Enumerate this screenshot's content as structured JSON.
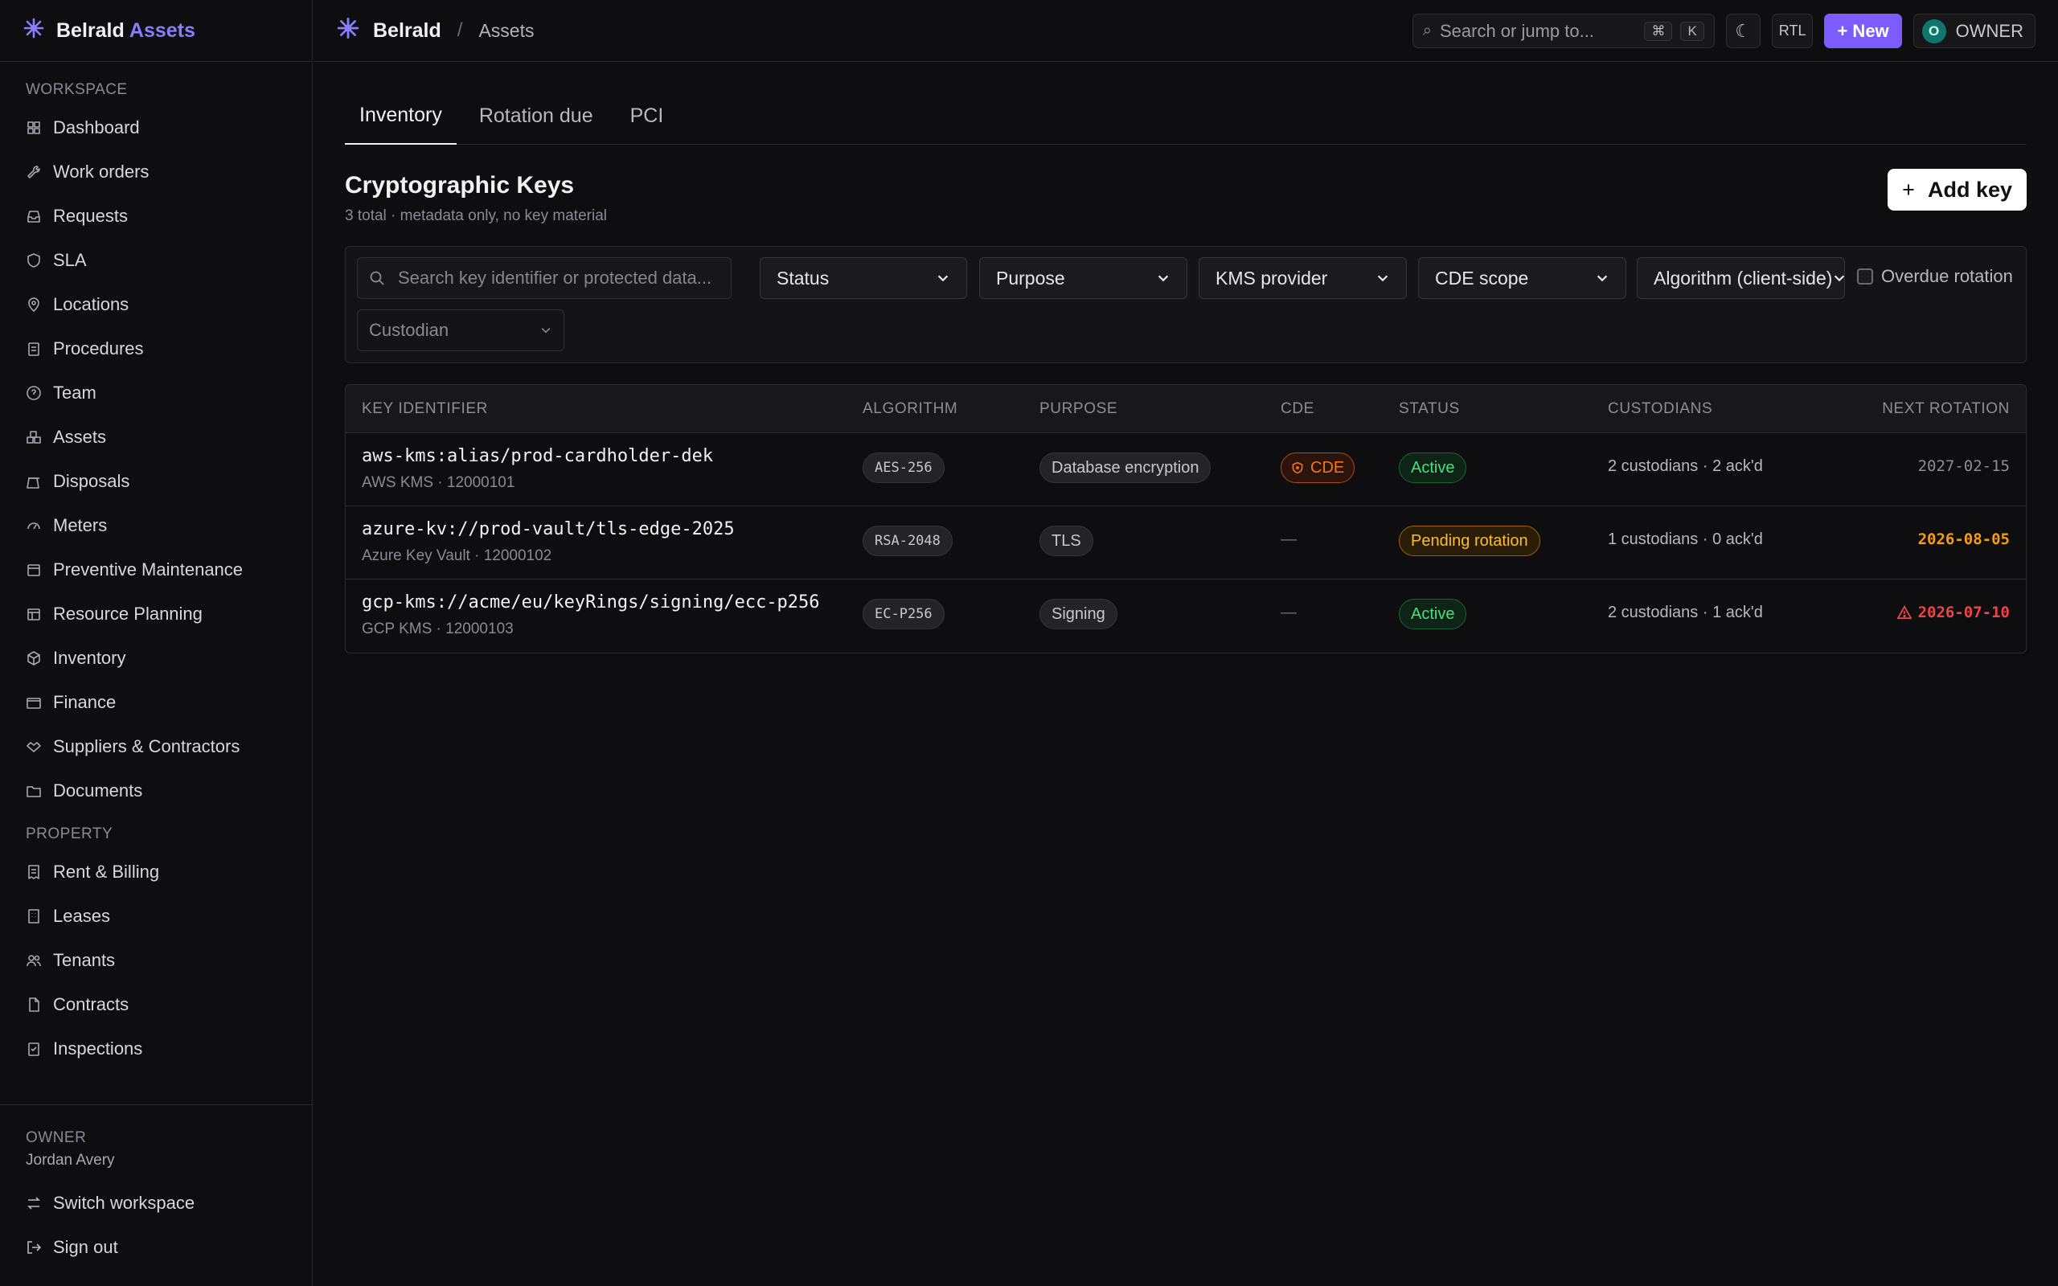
{
  "app": {
    "brand": "Belrald",
    "brand_accent": "Assets",
    "accent_color": "#7c5cff"
  },
  "sidebar": {
    "workspace_label": "WORKSPACE",
    "workspace_items": [
      {
        "label": "Dashboard",
        "icon": "dashboard-icon"
      },
      {
        "label": "Work orders",
        "icon": "wrench-icon"
      },
      {
        "label": "Requests",
        "icon": "inbox-icon"
      },
      {
        "label": "SLA",
        "icon": "shield-icon"
      },
      {
        "label": "Locations",
        "icon": "map-pin-icon"
      },
      {
        "label": "Procedures",
        "icon": "clipboard-icon"
      },
      {
        "label": "Team",
        "icon": "help-circle-icon"
      },
      {
        "label": "Assets",
        "icon": "boxes-icon"
      },
      {
        "label": "Disposals",
        "icon": "recycle-icon"
      },
      {
        "label": "Meters",
        "icon": "gauge-icon"
      },
      {
        "label": "Preventive Maintenance",
        "icon": "calendar-icon"
      },
      {
        "label": "Resource Planning",
        "icon": "calendar-grid-icon"
      },
      {
        "label": "Inventory",
        "icon": "package-icon"
      },
      {
        "label": "Finance",
        "icon": "wallet-icon"
      },
      {
        "label": "Suppliers & Contractors",
        "icon": "handshake-icon"
      },
      {
        "label": "Documents",
        "icon": "folder-icon"
      }
    ],
    "property_label": "PROPERTY",
    "property_items": [
      {
        "label": "Rent & Billing",
        "icon": "receipt-icon"
      },
      {
        "label": "Leases",
        "icon": "building-icon"
      },
      {
        "label": "Tenants",
        "icon": "users-icon"
      },
      {
        "label": "Contracts",
        "icon": "file-icon"
      },
      {
        "label": "Inspections",
        "icon": "clipboard-check-icon"
      }
    ],
    "owner_role": "OWNER",
    "owner_name": "Jordan Avery",
    "switch_workspace": "Switch workspace",
    "sign_out": "Sign out"
  },
  "topbar": {
    "breadcrumb_brand": "Belrald",
    "breadcrumb_sep": "/",
    "breadcrumb_page": "Assets",
    "search_placeholder": "Search or jump to...",
    "kbd_cmd": "⌘",
    "kbd_k": "K",
    "rtl_label": "RTL",
    "new_label": "+ New",
    "avatar_initial": "O",
    "role_label": "OWNER"
  },
  "tabs": [
    "Inventory",
    "Rotation due",
    "PCI"
  ],
  "page": {
    "title": "Cryptographic Keys",
    "subtitle": "3 total · metadata only, no key material",
    "add_label": "Add key"
  },
  "filters": {
    "search_placeholder": "Search key identifier or protected data...",
    "status": "Status",
    "purpose": "Purpose",
    "kms": "KMS provider",
    "cde": "CDE scope",
    "algorithm": "Algorithm (client-side)",
    "overdue": "Overdue rotation",
    "custodian": "Custodian"
  },
  "table": {
    "headers": [
      "KEY IDENTIFIER",
      "ALGORITHM",
      "PURPOSE",
      "CDE",
      "STATUS",
      "CUSTODIANS",
      "NEXT ROTATION"
    ],
    "rows": [
      {
        "id": "aws-kms:alias/prod-cardholder-dek",
        "sub": "AWS KMS · 12000101",
        "algorithm": "AES-256",
        "purpose": "Database encryption",
        "cde": "CDE",
        "status": "Active",
        "custodians": "2 custodians · 2 ack'd",
        "rotation": "2027-02-15"
      },
      {
        "id": "azure-kv://prod-vault/tls-edge-2025",
        "sub": "Azure Key Vault · 12000102",
        "algorithm": "RSA-2048",
        "purpose": "TLS",
        "cde": "—",
        "status": "Pending rotation",
        "custodians": "1 custodians · 0 ack'd",
        "rotation": "2026-08-05"
      },
      {
        "id": "gcp-kms://acme/eu/keyRings/signing/ecc-p256",
        "sub": "GCP KMS · 12000103",
        "algorithm": "EC-P256",
        "purpose": "Signing",
        "cde": "—",
        "status": "Active",
        "custodians": "2 custodians · 1 ack'd",
        "rotation": "2026-07-10"
      }
    ]
  }
}
